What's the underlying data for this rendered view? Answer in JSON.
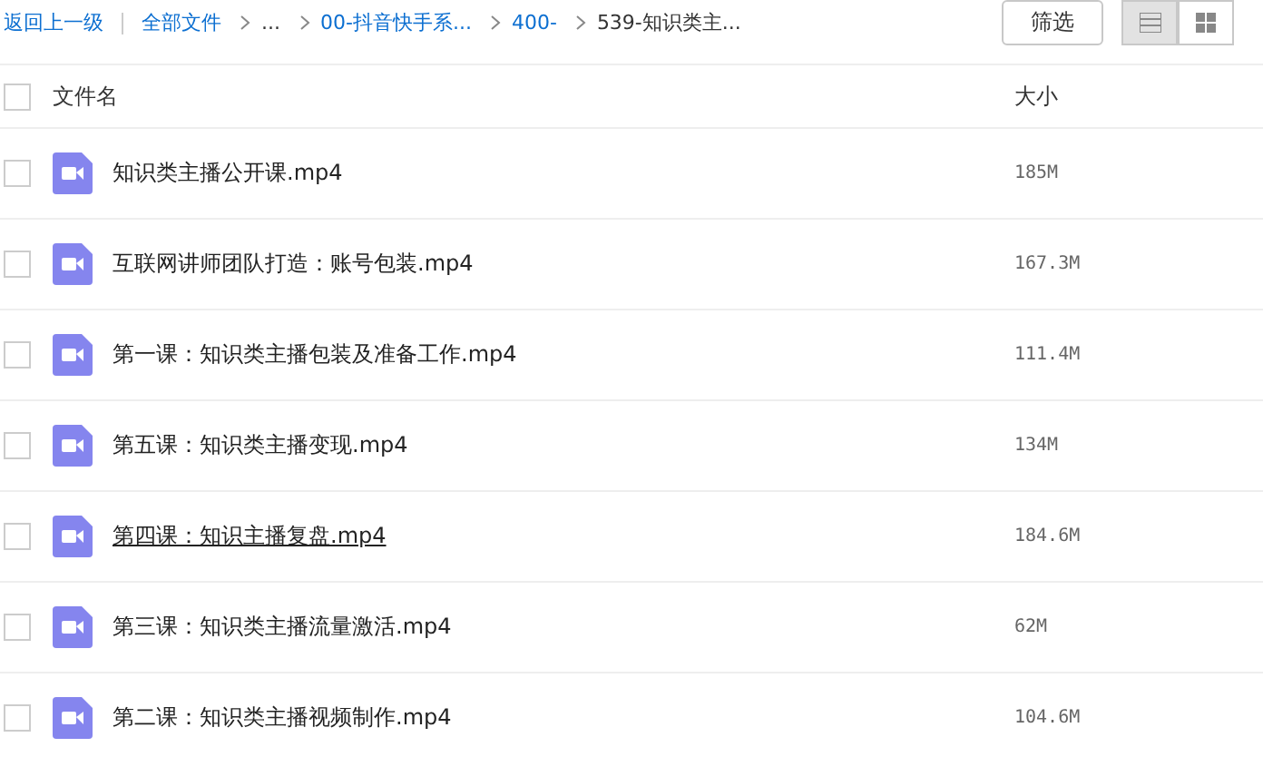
{
  "breadcrumb": [
    {
      "label": "返回上一级",
      "kind": "link"
    },
    {
      "label": "全部文件",
      "kind": "link"
    },
    {
      "label": "...",
      "kind": "text"
    },
    {
      "label": "00-抖音快手系...",
      "kind": "link"
    },
    {
      "label": "400-",
      "kind": "link"
    },
    {
      "label": "539-知识类主...",
      "kind": "current"
    }
  ],
  "filter_button": "筛选",
  "views": [
    {
      "kind": "list",
      "selected": true
    },
    {
      "kind": "grid",
      "selected": false
    }
  ],
  "columns": [
    "文件名",
    "大小"
  ],
  "select_all_checked": false,
  "files": [
    {
      "name": "知识类主播公开课.mp4",
      "size": "185M",
      "checked": false,
      "hovered": false
    },
    {
      "name": "互联网讲师团队打造：账号包装.mp4",
      "size": "167.3M",
      "checked": false,
      "hovered": false
    },
    {
      "name": "第一课：知识类主播包装及准备工作.mp4",
      "size": "111.4M",
      "checked": false,
      "hovered": false
    },
    {
      "name": "第五课：知识类主播变现.mp4",
      "size": "134M",
      "checked": false,
      "hovered": false
    },
    {
      "name": "第四课：知识主播复盘.mp4",
      "size": "184.6M",
      "checked": false,
      "hovered": true
    },
    {
      "name": "第三课：知识类主播流量激活.mp4",
      "size": "62M",
      "checked": false,
      "hovered": false
    },
    {
      "name": "第二课：知识类主播视频制作.mp4",
      "size": "104.6M",
      "checked": false,
      "hovered": false
    }
  ]
}
